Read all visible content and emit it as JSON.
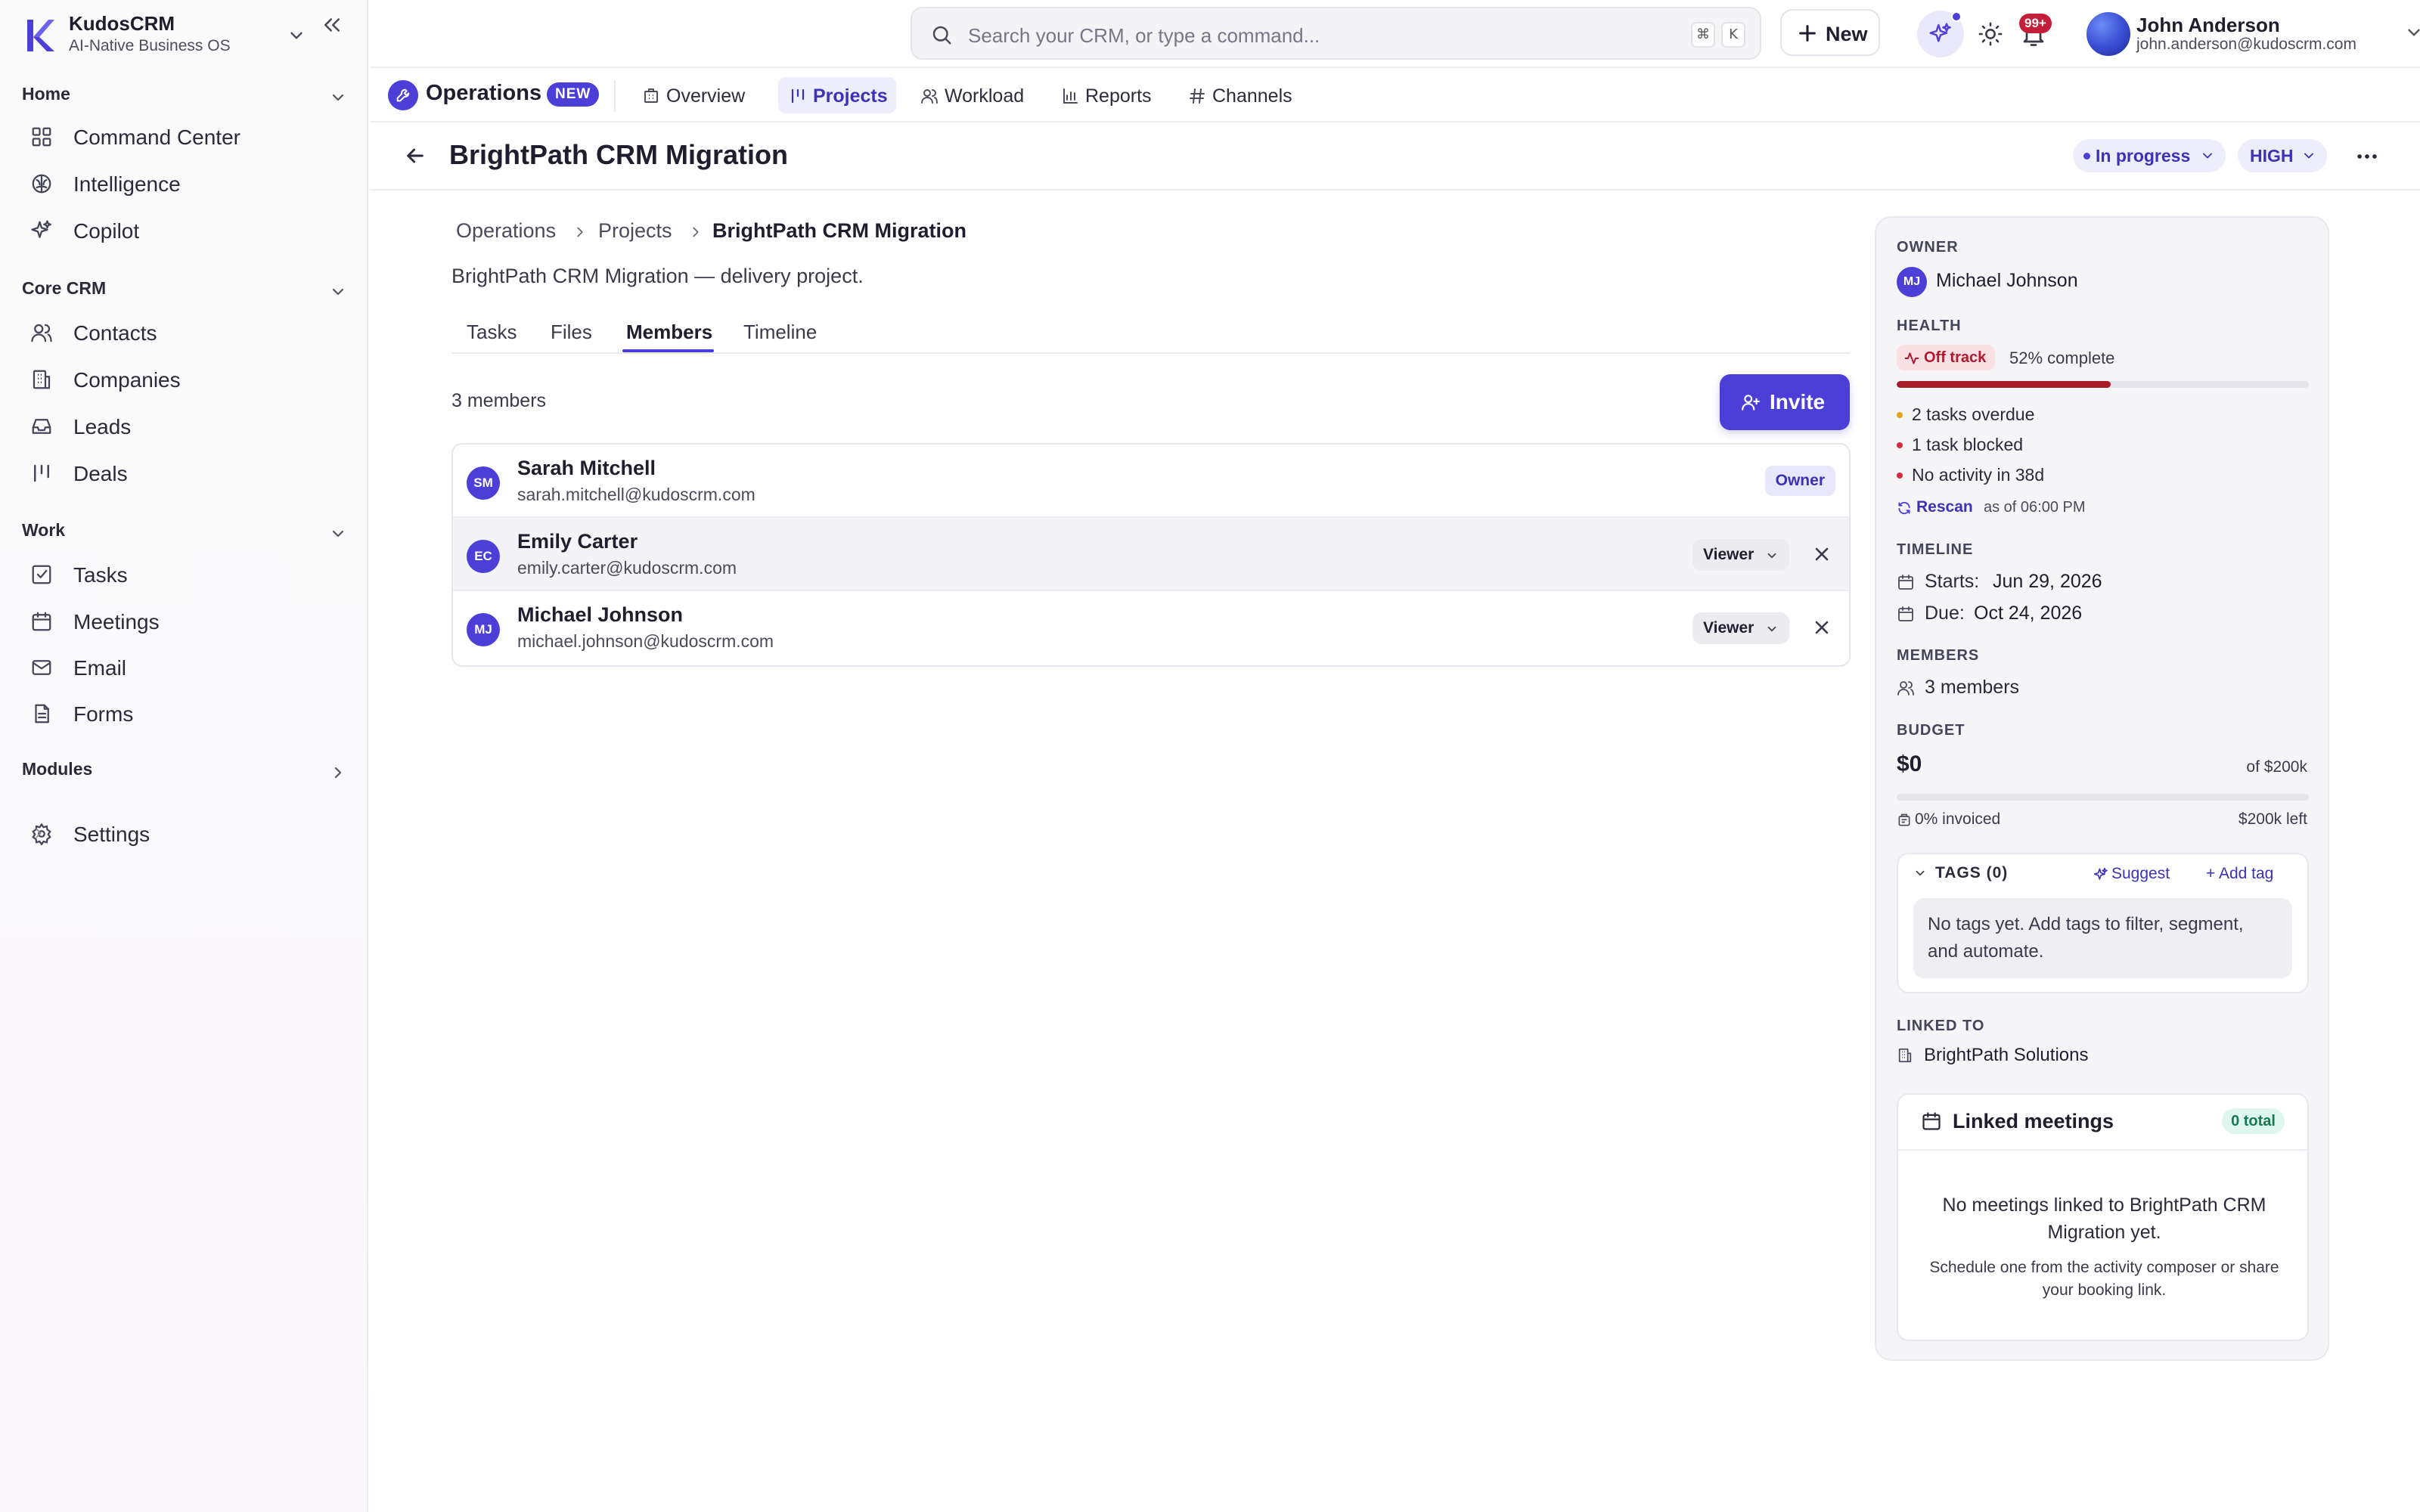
{
  "brand": {
    "name": "KudosCRM",
    "tagline": "AI-Native Business OS"
  },
  "sidebar": {
    "sections": [
      {
        "label": "Home",
        "items": [
          {
            "label": "Command Center",
            "icon": "grid-icon"
          },
          {
            "label": "Intelligence",
            "icon": "brain-icon"
          },
          {
            "label": "Copilot",
            "icon": "sparkle-icon"
          }
        ]
      },
      {
        "label": "Core CRM",
        "items": [
          {
            "label": "Contacts",
            "icon": "users-icon"
          },
          {
            "label": "Companies",
            "icon": "building-icon"
          },
          {
            "label": "Leads",
            "icon": "inbox-icon"
          },
          {
            "label": "Deals",
            "icon": "kanban-icon"
          }
        ]
      },
      {
        "label": "Work",
        "items": [
          {
            "label": "Tasks",
            "icon": "checkbox-icon"
          },
          {
            "label": "Meetings",
            "icon": "calendar-icon"
          },
          {
            "label": "Email",
            "icon": "mail-icon"
          },
          {
            "label": "Forms",
            "icon": "document-icon"
          }
        ]
      },
      {
        "label": "Modules",
        "items": []
      }
    ],
    "settings_label": "Settings"
  },
  "topbar": {
    "search_placeholder": "Search your CRM, or type a command...",
    "shortcut_keys": [
      "⌘",
      "K"
    ],
    "new_label": "New",
    "notification_count": "99+",
    "user": {
      "name": "John Anderson",
      "email": "john.anderson@kudoscrm.com"
    }
  },
  "subnav": {
    "title": "Operations",
    "badge": "NEW",
    "tabs": [
      {
        "label": "Overview",
        "icon": "building-icon"
      },
      {
        "label": "Projects",
        "icon": "kanban-icon",
        "active": true
      },
      {
        "label": "Workload",
        "icon": "users-icon"
      },
      {
        "label": "Reports",
        "icon": "bar-chart-icon"
      },
      {
        "label": "Channels",
        "icon": "hash-icon"
      }
    ]
  },
  "page": {
    "title": "BrightPath CRM Migration",
    "status": "In progress",
    "priority": "HIGH",
    "breadcrumb": [
      "Operations",
      "Projects",
      "BrightPath CRM Migration"
    ],
    "description": "BrightPath CRM Migration — delivery project.",
    "tabs": [
      "Tasks",
      "Files",
      "Members",
      "Timeline"
    ],
    "active_tab": "Members",
    "member_count_text": "3 members",
    "invite_label": "Invite",
    "members": [
      {
        "initials": "SM",
        "name": "Sarah Mitchell",
        "email": "sarah.mitchell@kudoscrm.com",
        "role": "Owner"
      },
      {
        "initials": "EC",
        "name": "Emily Carter",
        "email": "emily.carter@kudoscrm.com",
        "role": "Viewer"
      },
      {
        "initials": "MJ",
        "name": "Michael Johnson",
        "email": "michael.johnson@kudoscrm.com",
        "role": "Viewer"
      }
    ]
  },
  "panel": {
    "owner_label": "OWNER",
    "owner": {
      "initials": "MJ",
      "name": "Michael Johnson"
    },
    "health_label": "HEALTH",
    "health_status": "Off track",
    "health_percent_text": "52% complete",
    "health_percent": 0.52,
    "alerts": [
      {
        "text": "2 tasks overdue",
        "color": "#e8a21a"
      },
      {
        "text": "1 task blocked",
        "color": "#d42a3c"
      },
      {
        "text": "No activity in 38d",
        "color": "#d42a3c"
      }
    ],
    "rescan_label": "Rescan",
    "rescan_time": "as of 06:00 PM",
    "timeline_label": "TIMELINE",
    "starts_label": "Starts:",
    "starts": "Jun 29, 2026",
    "due_label": "Due:",
    "due": "Oct 24, 2026",
    "members_label": "MEMBERS",
    "members_text": "3 members",
    "budget_label": "BUDGET",
    "budget_amount": "$0",
    "budget_of": "of $200k",
    "budget_fraction": 0,
    "invoiced": "0% invoiced",
    "budget_left": "$200k left",
    "tags_label": "TAGS (0)",
    "suggest_label": "Suggest",
    "add_tag_label": "+ Add tag",
    "tags_empty": "No tags yet. Add tags to filter, segment, and automate.",
    "linked_label": "LINKED TO",
    "linked_company": "BrightPath Solutions",
    "meetings_title": "Linked meetings",
    "meetings_count": "0 total",
    "meetings_empty": "No meetings linked to BrightPath CRM Migration yet.",
    "meetings_hint": "Schedule one from the activity composer or share your booking link."
  },
  "colors": {
    "accent": "#4b3fd8",
    "danger": "#a81c2a",
    "warning": "#e8a21a",
    "success_bg": "#dff6ee"
  }
}
